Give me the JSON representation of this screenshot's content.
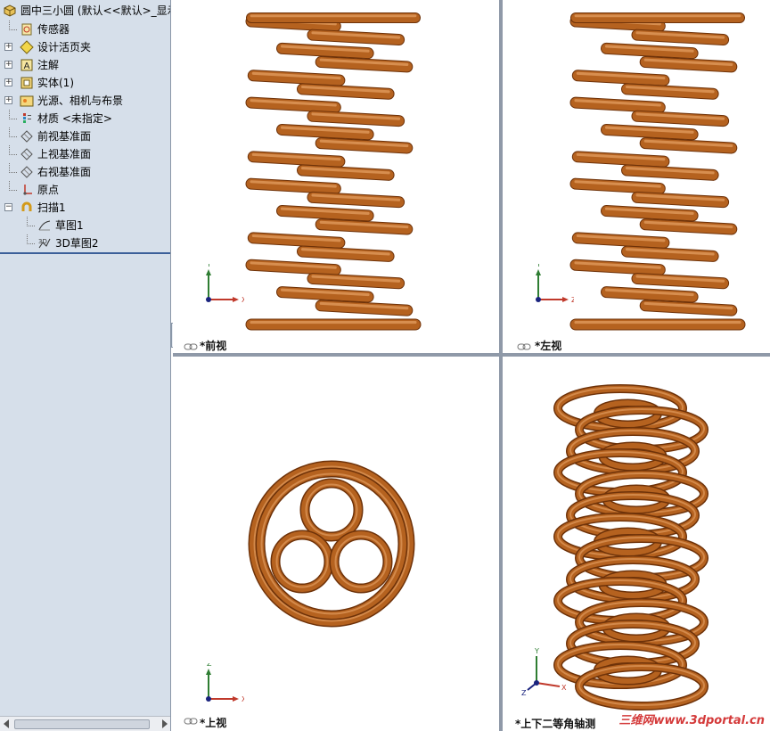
{
  "tree": {
    "root": "圆中三小圆 (默认<<默认>_显示",
    "items": [
      {
        "id": "sensors",
        "label": "传感器",
        "expandable": false
      },
      {
        "id": "design-binder",
        "label": "设计活页夹",
        "expandable": true
      },
      {
        "id": "annotations",
        "label": "注解",
        "expandable": true
      },
      {
        "id": "solid-bodies",
        "label": "实体(1)",
        "expandable": true
      },
      {
        "id": "lights-cameras",
        "label": "光源、相机与布景",
        "expandable": true
      },
      {
        "id": "material",
        "label": "材质 <未指定>",
        "expandable": false
      },
      {
        "id": "front-plane",
        "label": "前视基准面",
        "expandable": false
      },
      {
        "id": "top-plane",
        "label": "上视基准面",
        "expandable": false
      },
      {
        "id": "right-plane",
        "label": "右视基准面",
        "expandable": false
      },
      {
        "id": "origin",
        "label": "原点",
        "expandable": false
      },
      {
        "id": "sweep1",
        "label": "扫描1",
        "expandable": true,
        "expanded": true
      },
      {
        "id": "sketch1",
        "label": "草图1",
        "expandable": false,
        "child": true
      },
      {
        "id": "sketch3d2",
        "label": "3D草图2",
        "expandable": false,
        "child": true
      }
    ]
  },
  "views": {
    "front": {
      "label": "*前视",
      "axis_h": "X",
      "axis_v": "Y"
    },
    "left": {
      "label": "*左视",
      "axis_h": "Z",
      "axis_v": "Y"
    },
    "top": {
      "label": "*上视",
      "axis_h": "X",
      "axis_v": "Z"
    },
    "iso": {
      "label": "*上下二等角轴测",
      "axis_h": "X",
      "axis_v": "Y",
      "axis_d": "Z"
    }
  },
  "watermark": "三维网www.3dportal.cn",
  "colors": {
    "coil": "#b5621f",
    "coil_dark": "#6e3209",
    "coil_light": "#e09a5c",
    "tree_bg": "#d6dfea"
  }
}
